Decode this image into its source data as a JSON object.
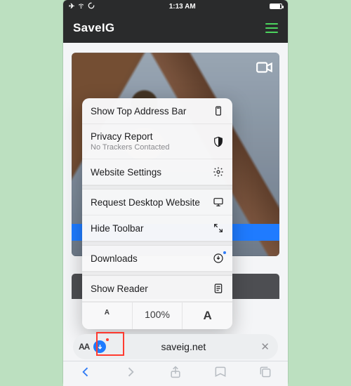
{
  "status": {
    "time": "1:13 AM",
    "icons": {
      "airplane": "✈",
      "wifi": "wifi",
      "spinner": "loading"
    }
  },
  "header": {
    "brand": "SaveIG"
  },
  "menu": {
    "show_top": "Show Top Address Bar",
    "privacy": {
      "title": "Privacy Report",
      "subtitle": "No Trackers Contacted"
    },
    "website_settings": "Website Settings",
    "request_desktop": "Request Desktop Website",
    "hide_toolbar": "Hide Toolbar",
    "downloads": "Downloads",
    "show_reader": "Show Reader",
    "zoom": {
      "dec": "A",
      "pct": "100%",
      "inc": "A"
    }
  },
  "url_bar": {
    "aa": "AA",
    "domain": "saveig.net"
  },
  "toolbar": {
    "back": "back",
    "forward": "forward",
    "share": "share",
    "bookmarks": "bookmarks",
    "tabs": "tabs"
  }
}
